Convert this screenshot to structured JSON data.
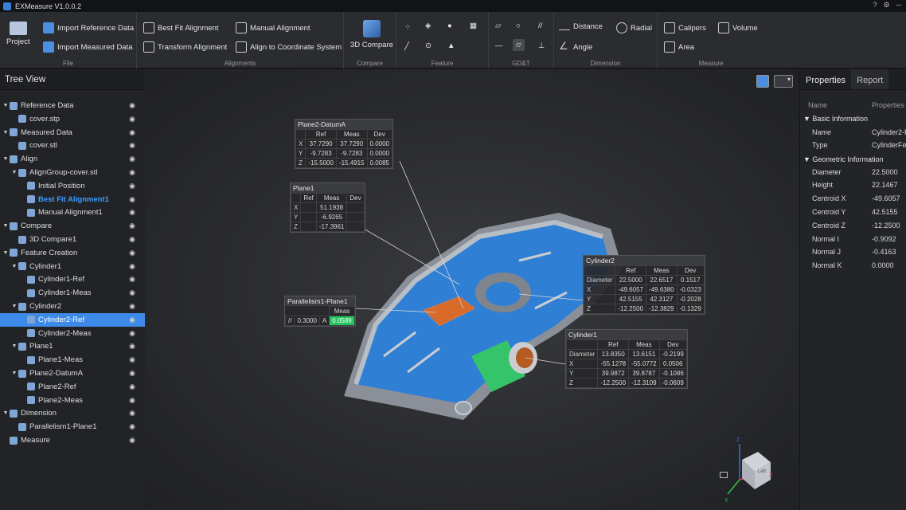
{
  "app": {
    "title": "EXMeasure V1.0.0.2"
  },
  "ribbon": {
    "file": {
      "group_label": "File",
      "project": "Project",
      "import_ref": "Import Reference Data",
      "import_meas": "Import Measured Data"
    },
    "alignments": {
      "group_label": "Alignments",
      "best_fit": "Best Fit Alignment",
      "manual": "Manual Alignment",
      "transform": "Transform Alignment",
      "align_cs": "Align to Coordinate System"
    },
    "compare": {
      "group_label": "Compare",
      "compare_3d": "3D Compare"
    },
    "feature": {
      "group_label": "Feature"
    },
    "gdt": {
      "group_label": "GD&T"
    },
    "dimension": {
      "group_label": "Dimension",
      "distance": "Distance",
      "radial": "Radial",
      "angle": "Angle"
    },
    "measure": {
      "group_label": "Measure",
      "calipers": "Calipers",
      "volume": "Volume",
      "area": "Area"
    }
  },
  "tree": {
    "title": "Tree View",
    "rows": [
      {
        "label": "Reference Data",
        "level": 0,
        "arrow": "▼"
      },
      {
        "label": "cover.stp",
        "level": 1,
        "arrow": ""
      },
      {
        "label": "Measured Data",
        "level": 0,
        "arrow": "▼"
      },
      {
        "label": "cover.stl",
        "level": 1,
        "arrow": ""
      },
      {
        "label": "Align",
        "level": 0,
        "arrow": "▼"
      },
      {
        "label": "AlignGroup-cover.stl",
        "level": 1,
        "arrow": "▼"
      },
      {
        "label": "Initial Position",
        "level": 2,
        "arrow": ""
      },
      {
        "label": "Best Fit Alignment1",
        "level": 2,
        "arrow": "",
        "active": true
      },
      {
        "label": "Manual Alignment1",
        "level": 2,
        "arrow": ""
      },
      {
        "label": "Compare",
        "level": 0,
        "arrow": "▼"
      },
      {
        "label": "3D Compare1",
        "level": 1,
        "arrow": ""
      },
      {
        "label": "Feature Creation",
        "level": 0,
        "arrow": "▼"
      },
      {
        "label": "Cylinder1",
        "level": 1,
        "arrow": "▼"
      },
      {
        "label": "Cylinder1-Ref",
        "level": 2,
        "arrow": ""
      },
      {
        "label": "Cylinder1-Meas",
        "level": 2,
        "arrow": ""
      },
      {
        "label": "Cylinder2",
        "level": 1,
        "arrow": "▼"
      },
      {
        "label": "Cylinder2-Ref",
        "level": 2,
        "arrow": "",
        "selected": true
      },
      {
        "label": "Cylinder2-Meas",
        "level": 2,
        "arrow": ""
      },
      {
        "label": "Plane1",
        "level": 1,
        "arrow": "▼"
      },
      {
        "label": "Plane1-Meas",
        "level": 2,
        "arrow": ""
      },
      {
        "label": "Plane2-DatumA",
        "level": 1,
        "arrow": "▼"
      },
      {
        "label": "Plane2-Ref",
        "level": 2,
        "arrow": ""
      },
      {
        "label": "Plane2-Meas",
        "level": 2,
        "arrow": ""
      },
      {
        "label": "Dimension",
        "level": 0,
        "arrow": "▼"
      },
      {
        "label": "Parallelism1-Plane1",
        "level": 1,
        "arrow": ""
      },
      {
        "label": "Measure",
        "level": 0,
        "arrow": ""
      }
    ]
  },
  "properties": {
    "tab_properties": "Properties",
    "tab_report": "Report",
    "col_name": "Name",
    "col_props": "Properties",
    "section_basic": "Basic Information",
    "section_geo": "Geometric Information",
    "basic": [
      {
        "k": "Name",
        "v": "Cylinder2-R"
      },
      {
        "k": "Type",
        "v": "CylinderFe"
      }
    ],
    "geo": [
      {
        "k": "Diameter",
        "v": "22.5000"
      },
      {
        "k": "Height",
        "v": "22.1467"
      },
      {
        "k": "Centroid X",
        "v": "-49.6057"
      },
      {
        "k": "Centroid Y",
        "v": "42.5155"
      },
      {
        "k": "Centroid Z",
        "v": "-12.2500"
      },
      {
        "k": "Normal I",
        "v": "-0.9092"
      },
      {
        "k": "Normal J",
        "v": "-0.4163"
      },
      {
        "k": "Normal K",
        "v": "0.0000"
      }
    ]
  },
  "annotations": {
    "plane2": {
      "title": "Plane2-DatumA",
      "headers": [
        "",
        "Ref",
        "Meas",
        "Dev"
      ],
      "rows": [
        [
          "X",
          "37.7290",
          "37.7290",
          "0.0000"
        ],
        [
          "Y",
          "-9.7283",
          "-9.7283",
          "0.0000"
        ],
        [
          "Z",
          "-15.5000",
          "-15.4915",
          "0.0085"
        ]
      ]
    },
    "plane1": {
      "title": "Plane1",
      "headers": [
        "",
        "Ref",
        "Meas",
        "Dev"
      ],
      "rows": [
        [
          "X",
          "",
          "51.1938",
          ""
        ],
        [
          "Y",
          "",
          "-6.9265",
          ""
        ],
        [
          "Z",
          "",
          "-17.3961",
          ""
        ]
      ]
    },
    "parallelism": {
      "title": "Parallelism1-Plane1",
      "meas_header": "Meas",
      "symbol": "//",
      "tol": "0.3000",
      "datum": "A",
      "meas": "0.0589"
    },
    "cylinder2": {
      "title": "Cylinder2",
      "headers": [
        "",
        "Ref",
        "Meas",
        "Dev"
      ],
      "rows": [
        [
          "Diameter",
          "22.5000",
          "22.6517",
          "0.1517"
        ],
        [
          "X",
          "-49.6057",
          "-49.6380",
          "-0.0323"
        ],
        [
          "Y",
          "42.5155",
          "42.3127",
          "-0.2028"
        ],
        [
          "Z",
          "-12.2500",
          "-12.3829",
          "-0.1329"
        ]
      ]
    },
    "cylinder1": {
      "title": "Cylinder1",
      "headers": [
        "",
        "Ref",
        "Meas",
        "Dev"
      ],
      "rows": [
        [
          "Diameter",
          "13.8350",
          "13.6151",
          "-0.2199"
        ],
        [
          "X",
          "-55.1278",
          "-55.0772",
          "0.0506"
        ],
        [
          "Y",
          "39.9872",
          "39.8787",
          "-0.1086"
        ],
        [
          "Z",
          "-12.2500",
          "-12.3109",
          "-0.0609"
        ]
      ]
    }
  },
  "axes": {
    "x": "X",
    "y": "Y",
    "z": "Z",
    "cube_face": "Left"
  },
  "colors": {
    "accent": "#3d8ae8",
    "part_blue": "#2f7fd4",
    "part_gray": "#9aa0a8",
    "plane_orange": "#d86a2a",
    "cyl_green": "#35c46a",
    "pass_green": "#22c55e"
  }
}
